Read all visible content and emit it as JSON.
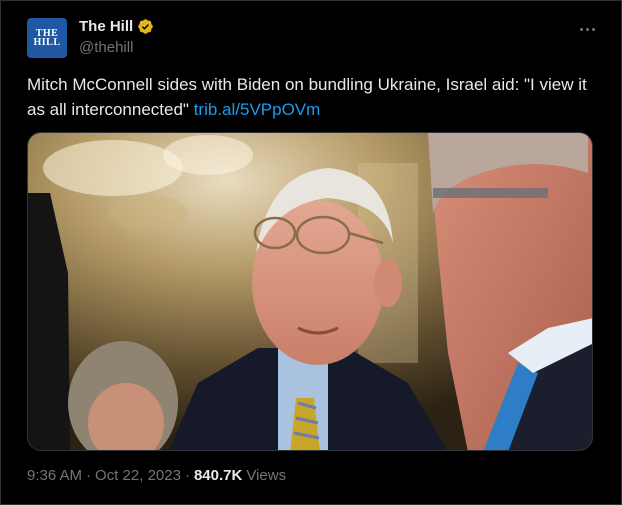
{
  "account": {
    "avatar_line1": "THE",
    "avatar_line2": "HILL",
    "display_name": "The Hill",
    "handle": "@thehill",
    "verified_badge": "gold-verified-icon"
  },
  "tweet": {
    "text": "Mitch McConnell sides with Biden on bundling Ukraine, Israel aid: \"I view it as all interconnected\" ",
    "link_text": "trib.al/5VPpOVm"
  },
  "meta": {
    "time": "9:36 AM",
    "separator1": "·",
    "date": "Oct 22, 2023",
    "separator2": "·",
    "views_count": "840.7K",
    "views_label": "Views"
  },
  "colors": {
    "background": "#000000",
    "text": "#e7e9ea",
    "muted": "#71767b",
    "link": "#1d9bf0",
    "verified_gold": "#e2b719",
    "avatar_blue": "#1f57a4"
  }
}
